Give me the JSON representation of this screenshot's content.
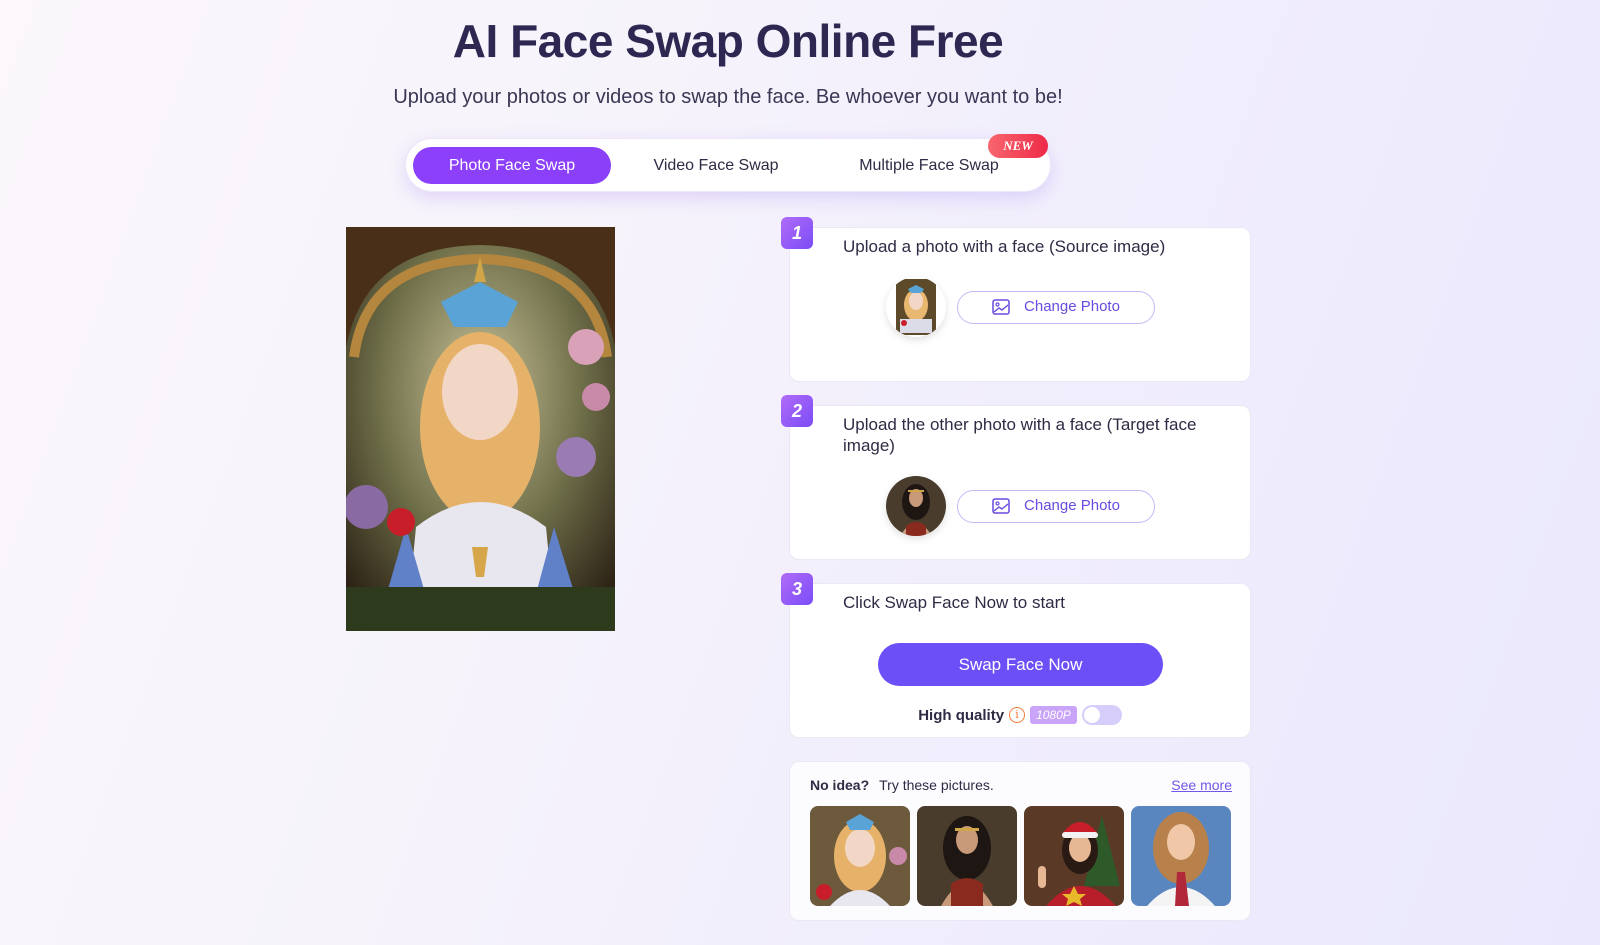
{
  "header": {
    "title": "AI Face Swap Online Free",
    "subtitle": "Upload your photos or videos to swap the face. Be whoever you want to be!"
  },
  "tabs": [
    {
      "label": "Photo Face Swap",
      "active": true
    },
    {
      "label": "Video Face Swap",
      "active": false
    },
    {
      "label": "Multiple Face Swap",
      "active": false,
      "badge": "NEW"
    }
  ],
  "preview": {
    "alt": "Fantasy portrait of girl with blue bow headdress in floral archway"
  },
  "steps": [
    {
      "number": "1",
      "text": "Upload a photo with a face (Source image)",
      "button": "Change Photo",
      "thumb": "fantasy-girl"
    },
    {
      "number": "2",
      "text": "Upload the other photo with a face (Target face image)",
      "button": "Change Photo",
      "thumb": "warrior-woman"
    },
    {
      "number": "3",
      "text": "Click Swap Face Now to start",
      "button": "Swap Face Now"
    }
  ],
  "quality": {
    "label": "High quality",
    "info_icon": "info-icon",
    "resolution": "1080P",
    "enabled": false
  },
  "ideas": {
    "label_bold": "No idea?",
    "label": "Try these pictures.",
    "see_more": "See more",
    "samples": [
      "fantasy-girl",
      "warrior-woman",
      "christmas-woman",
      "schoolgirl-uniform"
    ]
  },
  "colors": {
    "accent": "#8a3ffc",
    "button": "#6c4ff6",
    "new_badge": "#ee2a48"
  }
}
